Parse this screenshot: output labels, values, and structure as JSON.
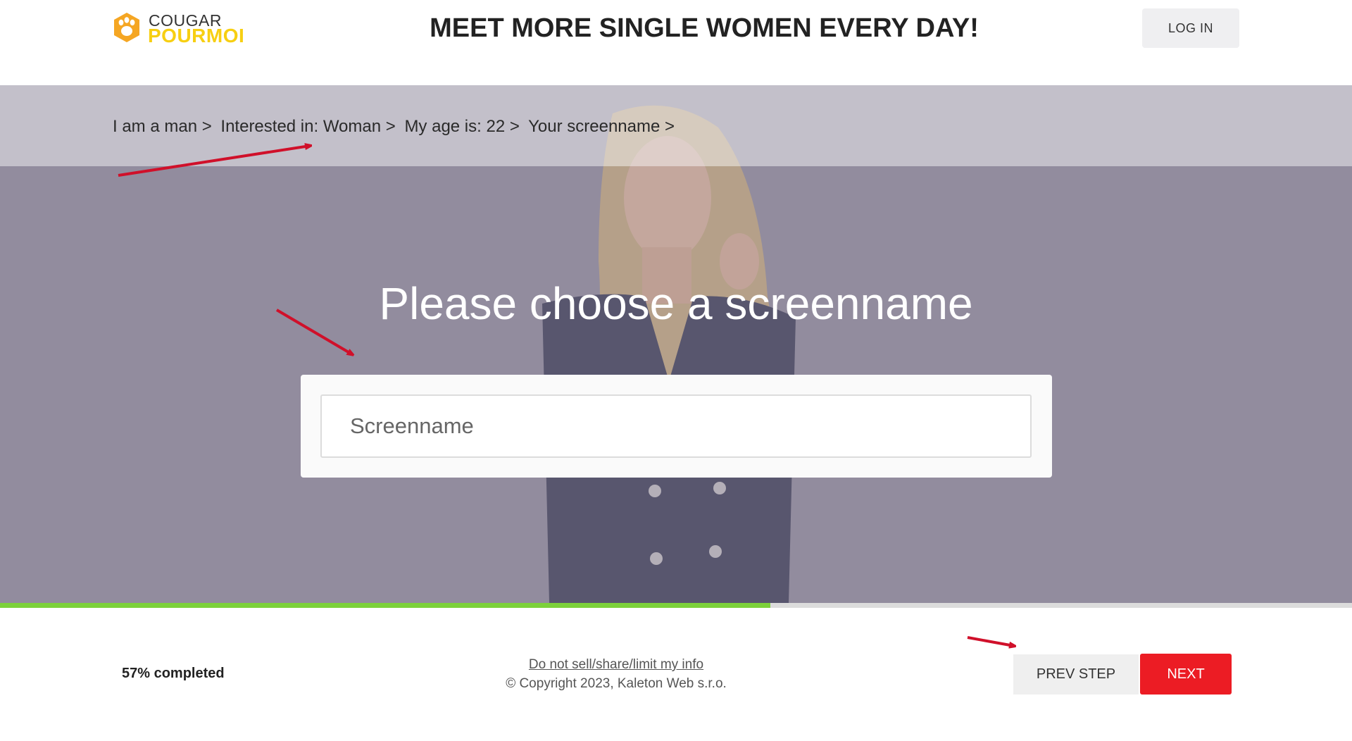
{
  "header": {
    "logo_top": "COUGAR",
    "logo_bottom": "POURMOI",
    "headline": "MEET MORE SINGLE WOMEN EVERY DAY!",
    "login_label": "LOG IN"
  },
  "breadcrumb": {
    "items": [
      "I am a man >",
      "Interested in: Woman >",
      "My age is: 22 >",
      "Your screenname >"
    ]
  },
  "hero": {
    "title": "Please choose a screenname"
  },
  "form": {
    "screenname_placeholder": "Screenname",
    "screenname_value": ""
  },
  "progress": {
    "percent": 57,
    "completed_label": "57% completed"
  },
  "footer": {
    "privacy_link": "Do not sell/share/limit my info",
    "copyright": "© Copyright 2023, Kaleton Web s.r.o.",
    "prev_label": "PREV STEP",
    "next_label": "NEXT"
  },
  "colors": {
    "accent_red": "#ec1c24",
    "logo_yellow": "#f7cf12",
    "progress_green": "#7cd13a",
    "annotation_red": "#d0102a"
  }
}
